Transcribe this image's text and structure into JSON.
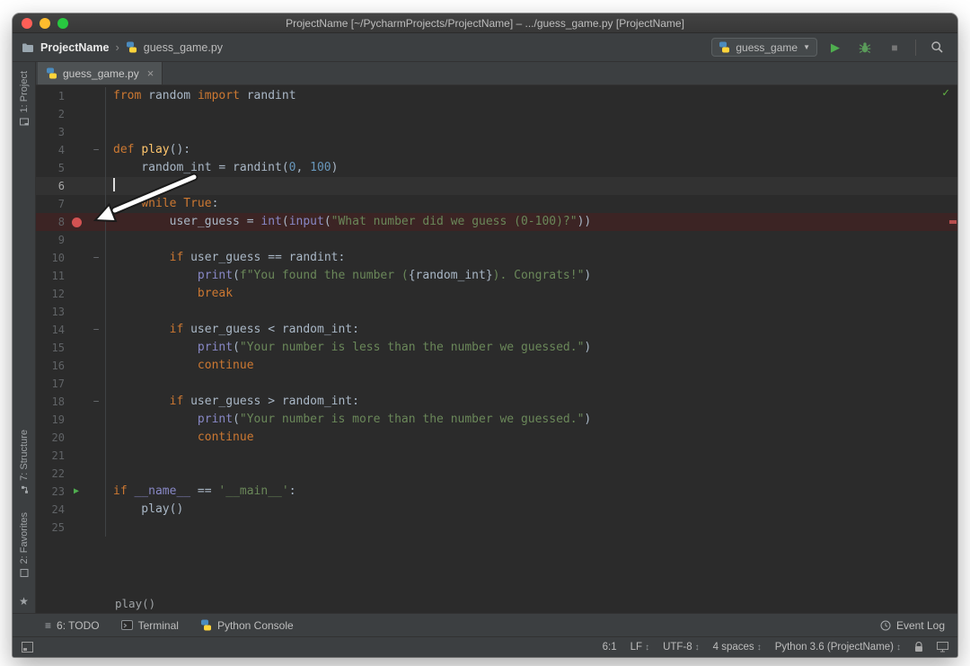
{
  "window": {
    "title": "ProjectName [~/PycharmProjects/ProjectName] – .../guess_game.py [ProjectName]"
  },
  "colors": {
    "traffic_red": "#ff5f57",
    "traffic_yellow": "#febc2e",
    "traffic_green": "#28c840",
    "editor_bg": "#2b2b2b",
    "panel_bg": "#3c3f41",
    "keyword": "#cc7832",
    "string": "#6a8759",
    "number": "#6897bb",
    "builtin": "#8888c6",
    "function_name": "#ffc66d",
    "plain_text": "#a9b7c6",
    "breakpoint_line_bg": "#3c2424",
    "breakpoint_dot": "#d25252",
    "run_green": "#4fae4f"
  },
  "toolbar": {
    "project": "ProjectName",
    "separator": "›",
    "file": "guess_game.py",
    "run_config": "guess_game"
  },
  "tabbar": {
    "active_tab": "guess_game.py"
  },
  "strip": {
    "project": "1: Project",
    "structure": "7: Structure",
    "favorites": "2: Favorites"
  },
  "icons": {
    "dropdown": "▼",
    "run": "▶",
    "stop": "■",
    "close": "×",
    "check": "✓",
    "star": "★",
    "todo_list": "≡",
    "fold": "−",
    "run_gutter": "▶",
    "popup_arrows": "↕"
  },
  "editor": {
    "context": "play()",
    "lines": [
      {
        "n": 1,
        "t": [
          [
            "kw",
            "from"
          ],
          [
            "plain",
            " random "
          ],
          [
            "kw",
            "import"
          ],
          [
            "plain",
            " randint"
          ]
        ]
      },
      {
        "n": 2,
        "t": []
      },
      {
        "n": 3,
        "t": []
      },
      {
        "n": 4,
        "fold": true,
        "t": [
          [
            "kw",
            "def"
          ],
          [
            "plain",
            " "
          ],
          [
            "fn",
            "play"
          ],
          [
            "plain",
            "():"
          ]
        ]
      },
      {
        "n": 5,
        "t": [
          [
            "plain",
            "    random_int = randint("
          ],
          [
            "num",
            "0"
          ],
          [
            "plain",
            ", "
          ],
          [
            "num",
            "100"
          ],
          [
            "plain",
            ")"
          ]
        ]
      },
      {
        "n": 6,
        "cur": true,
        "cursor": true,
        "t": []
      },
      {
        "n": 7,
        "t": [
          [
            "plain",
            "    "
          ],
          [
            "kw",
            "while"
          ],
          [
            "plain",
            " "
          ],
          [
            "kw",
            "True"
          ],
          [
            "plain",
            ":"
          ]
        ]
      },
      {
        "n": 8,
        "bp": true,
        "t": [
          [
            "plain",
            "        user_guess = "
          ],
          [
            "builtin",
            "int"
          ],
          [
            "plain",
            "("
          ],
          [
            "builtin",
            "input"
          ],
          [
            "plain",
            "("
          ],
          [
            "str",
            "\"What number did we guess (0-100)?\""
          ],
          [
            "plain",
            "))"
          ]
        ]
      },
      {
        "n": 9,
        "t": []
      },
      {
        "n": 10,
        "fold": true,
        "t": [
          [
            "plain",
            "        "
          ],
          [
            "kw",
            "if"
          ],
          [
            "plain",
            " user_guess == randint:"
          ]
        ]
      },
      {
        "n": 11,
        "t": [
          [
            "plain",
            "            "
          ],
          [
            "builtin",
            "print"
          ],
          [
            "plain",
            "("
          ],
          [
            "str",
            "f\"You found the number ("
          ],
          [
            "fexpr",
            "{random_int}"
          ],
          [
            "str",
            "). Congrats!\""
          ],
          [
            "plain",
            ")"
          ]
        ]
      },
      {
        "n": 12,
        "t": [
          [
            "plain",
            "            "
          ],
          [
            "kw",
            "break"
          ]
        ]
      },
      {
        "n": 13,
        "t": []
      },
      {
        "n": 14,
        "fold": true,
        "t": [
          [
            "plain",
            "        "
          ],
          [
            "kw",
            "if"
          ],
          [
            "plain",
            " user_guess < random_int:"
          ]
        ]
      },
      {
        "n": 15,
        "t": [
          [
            "plain",
            "            "
          ],
          [
            "builtin",
            "print"
          ],
          [
            "plain",
            "("
          ],
          [
            "str",
            "\"Your number is less than the number we guessed.\""
          ],
          [
            "plain",
            ")"
          ]
        ]
      },
      {
        "n": 16,
        "t": [
          [
            "plain",
            "            "
          ],
          [
            "kw",
            "continue"
          ]
        ]
      },
      {
        "n": 17,
        "t": []
      },
      {
        "n": 18,
        "fold": true,
        "t": [
          [
            "plain",
            "        "
          ],
          [
            "kw",
            "if"
          ],
          [
            "plain",
            " user_guess > random_int:"
          ]
        ]
      },
      {
        "n": 19,
        "t": [
          [
            "plain",
            "            "
          ],
          [
            "builtin",
            "print"
          ],
          [
            "plain",
            "("
          ],
          [
            "str",
            "\"Your number is more than the number we guessed.\""
          ],
          [
            "plain",
            ")"
          ]
        ]
      },
      {
        "n": 20,
        "t": [
          [
            "plain",
            "            "
          ],
          [
            "kw",
            "continue"
          ]
        ]
      },
      {
        "n": 21,
        "t": []
      },
      {
        "n": 22,
        "t": []
      },
      {
        "n": 23,
        "run": true,
        "t": [
          [
            "kw",
            "if"
          ],
          [
            "plain",
            " "
          ],
          [
            "builtin",
            "__name__"
          ],
          [
            "plain",
            " == "
          ],
          [
            "str",
            "'__main__'"
          ],
          [
            "plain",
            ":"
          ]
        ]
      },
      {
        "n": 24,
        "t": [
          [
            "plain",
            "    play()"
          ]
        ]
      },
      {
        "n": 25,
        "t": []
      }
    ]
  },
  "toolwindows": {
    "todo": "6: TODO",
    "terminal": "Terminal",
    "python_console": "Python Console",
    "event_log": "Event Log"
  },
  "statusbar": {
    "position": "6:1",
    "line_separator": "LF",
    "encoding": "UTF-8",
    "indent": "4 spaces",
    "interpreter": "Python 3.6 (ProjectName)"
  }
}
